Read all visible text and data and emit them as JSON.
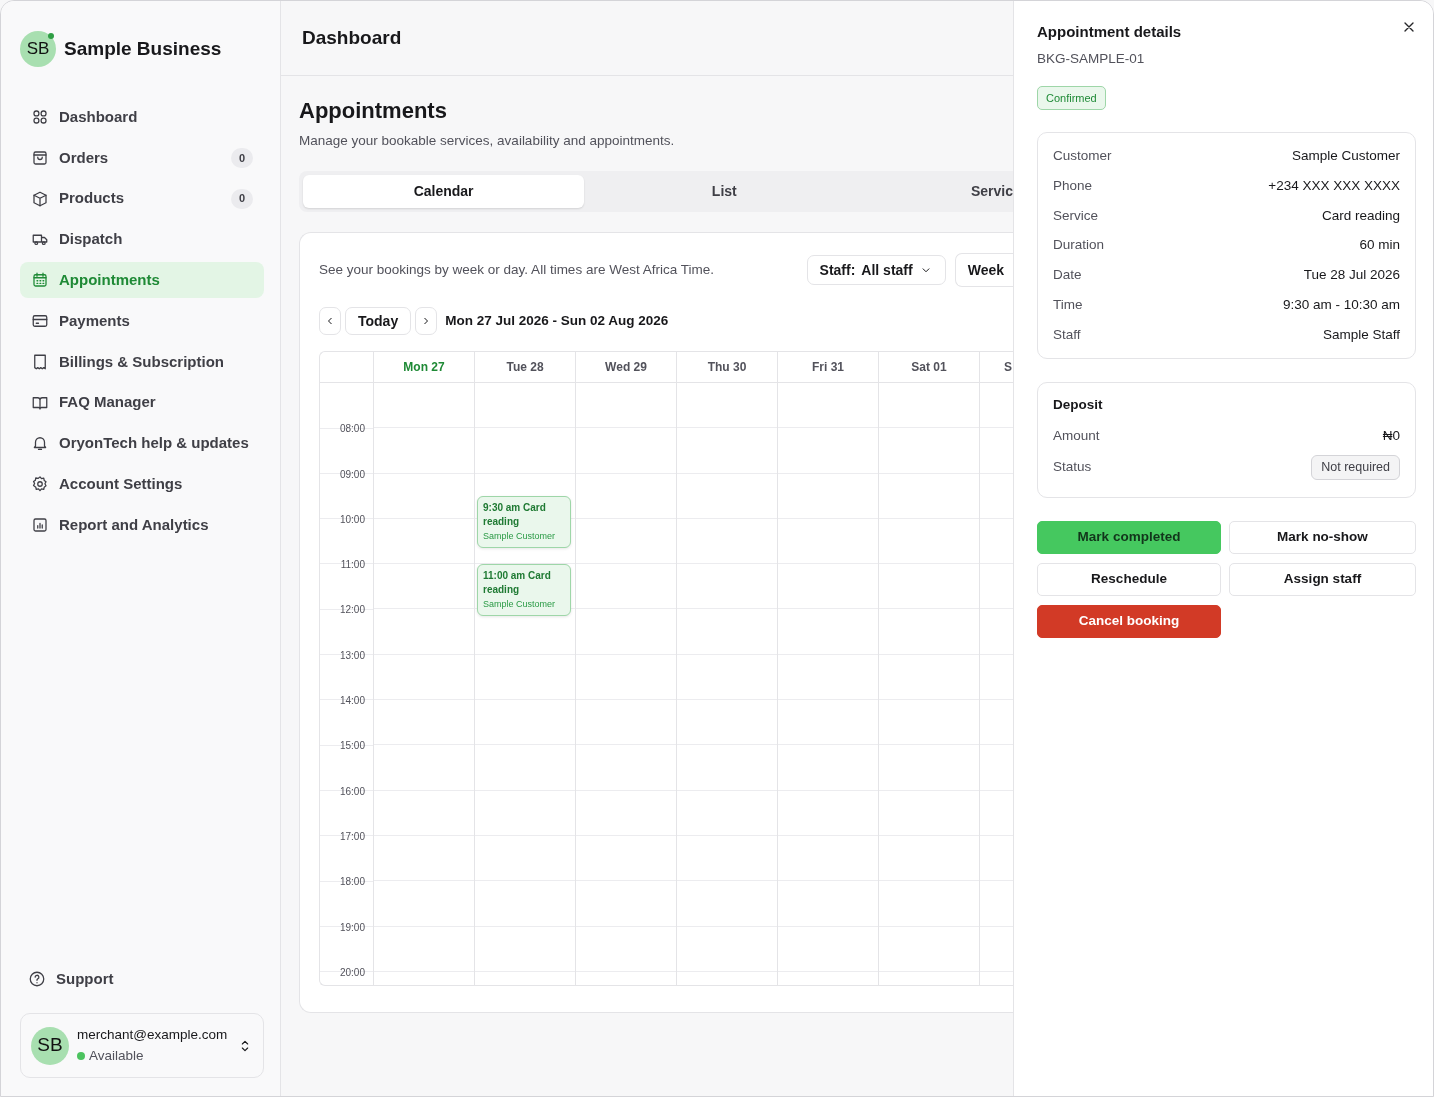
{
  "business": {
    "initials": "SB",
    "name": "Sample Business"
  },
  "sidebar": {
    "items": [
      {
        "label": "Dashboard",
        "selected": false
      },
      {
        "label": "Orders",
        "selected": false,
        "badge": "0"
      },
      {
        "label": "Products",
        "selected": false,
        "badge": "0"
      },
      {
        "label": "Dispatch",
        "selected": false
      },
      {
        "label": "Appointments",
        "selected": true
      },
      {
        "label": "Payments",
        "selected": false
      },
      {
        "label": "Billings & Subscription",
        "selected": false
      },
      {
        "label": "FAQ Manager",
        "selected": false
      },
      {
        "label": "OryonTech help & updates",
        "selected": false
      },
      {
        "label": "Account Settings",
        "selected": false
      },
      {
        "label": "Report and Analytics",
        "selected": false
      }
    ],
    "support": "Support",
    "user": {
      "initials": "SB",
      "email": "merchant@example.com",
      "status": "Available",
      "color": "#4cc35f"
    }
  },
  "header": {
    "title": "Dashboard"
  },
  "page": {
    "title": "Appointments",
    "subtitle": "Manage your bookable services, availability and appointments.",
    "tabs": [
      {
        "label": "Calendar",
        "selected": true
      },
      {
        "label": "List",
        "selected": false
      },
      {
        "label": "Servic",
        "selected": false
      }
    ]
  },
  "calendar": {
    "note": "See your bookings by week or day. All times are West Africa Time.",
    "staff_label": "Staff:",
    "staff_value": "All staff",
    "view": "Week",
    "today": "Today",
    "range": "Mon 27 Jul 2026 - Sun 02 Aug 2026",
    "days": [
      {
        "label": "Mon 27",
        "selected": true
      },
      {
        "label": "Tue 28",
        "selected": false,
        "events": [
          {
            "title": "9:30 am Card reading",
            "customer": "Sample Customer"
          },
          {
            "title": "11:00 am Card reading",
            "customer": "Sample Customer"
          }
        ]
      },
      {
        "label": "Wed 29",
        "selected": false
      },
      {
        "label": "Thu 30",
        "selected": false
      },
      {
        "label": "Fri 31",
        "selected": false
      },
      {
        "label": "Sat 01",
        "selected": false
      },
      {
        "label": "S",
        "selected": false
      }
    ],
    "hours": [
      "08:00",
      "09:00",
      "10:00",
      "11:00",
      "12:00",
      "13:00",
      "14:00",
      "15:00",
      "16:00",
      "17:00",
      "18:00",
      "19:00",
      "20:00"
    ]
  },
  "details": {
    "title": "Appointment details",
    "id": "BKG-SAMPLE-01",
    "status": "Confirmed",
    "fields": [
      {
        "label": "Customer",
        "value": "Sample Customer"
      },
      {
        "label": "Phone",
        "value": "+234 XXX XXX XXXX"
      },
      {
        "label": "Service",
        "value": "Card reading"
      },
      {
        "label": "Duration",
        "value": "60 min"
      },
      {
        "label": "Date",
        "value": "Tue 28 Jul 2026"
      },
      {
        "label": "Time",
        "value": "9:30 am - 10:30 am"
      },
      {
        "label": "Staff",
        "value": "Sample Staff"
      }
    ],
    "deposit": {
      "title": "Deposit",
      "amount_label": "Amount",
      "amount": "₦0",
      "status_label": "Status",
      "status": "Not required"
    },
    "actions": [
      {
        "label": "Mark completed",
        "kind": "success"
      },
      {
        "label": "Mark no-show",
        "kind": "outline"
      },
      {
        "label": "Reschedule",
        "kind": "outline"
      },
      {
        "label": "Assign staff",
        "kind": "outline"
      },
      {
        "label": "Cancel booking",
        "kind": "danger"
      }
    ]
  }
}
